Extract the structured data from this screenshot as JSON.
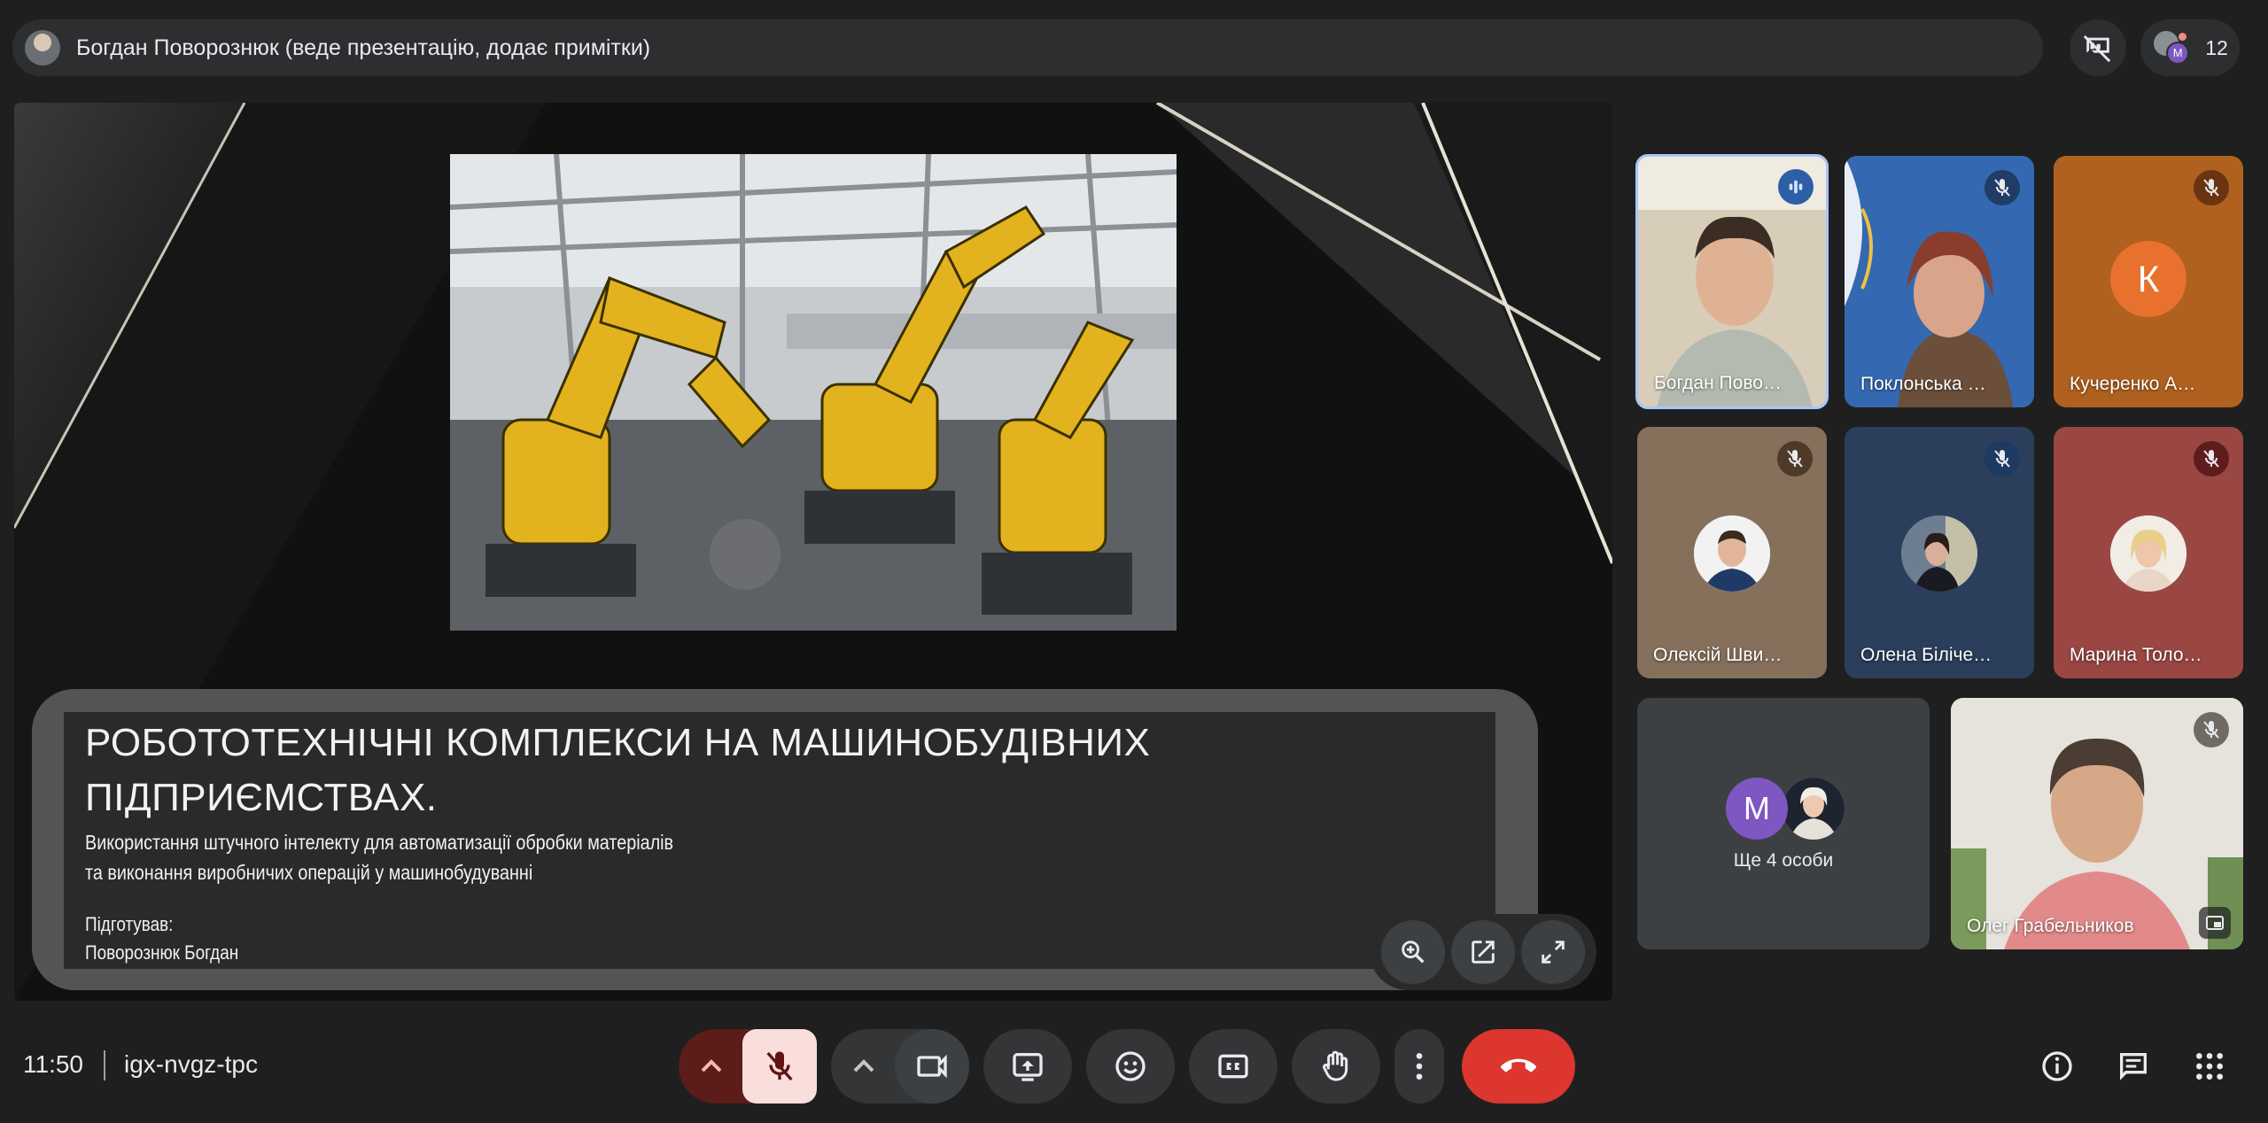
{
  "presenter": {
    "label": "Богдан Поворознюк (веде презентацію, додає примітки)"
  },
  "participants_count": "12",
  "slide": {
    "title_line1": "РОБОТОТЕХНІЧНІ КОМПЛЕКСИ НА МАШИНОБУДІВНИХ",
    "title_line2": "ПІДПРИЄМСТВАХ.",
    "subtitle_line1": "Використання штучного інтелекту для автоматизації обробки матеріалів",
    "subtitle_line2": "та виконання виробничих операцій у машинобудуванні",
    "author_label": "Підготував:",
    "author_name": "Поворознюк Богдан"
  },
  "tiles": [
    {
      "name": "Богдан Пово…",
      "muted": false
    },
    {
      "name": "Поклонська …",
      "muted": true
    },
    {
      "name": "Кучеренко А…",
      "muted": true,
      "initial": "К"
    },
    {
      "name": "Олексій Шви…",
      "muted": true
    },
    {
      "name": "Олена Біліче…",
      "muted": true
    },
    {
      "name": "Марина Толо…",
      "muted": true
    },
    {
      "name": "Ще 4 особи",
      "initial": "M"
    },
    {
      "name": "Олег Грабельников",
      "muted": true
    }
  ],
  "bottom": {
    "time": "11:50",
    "meeting_code": "igx-nvgz-tpc"
  },
  "colors": {
    "accent_muted": "#f9dedc",
    "end_call": "#dc362e",
    "tile_border_active": "#a8c7fa"
  }
}
